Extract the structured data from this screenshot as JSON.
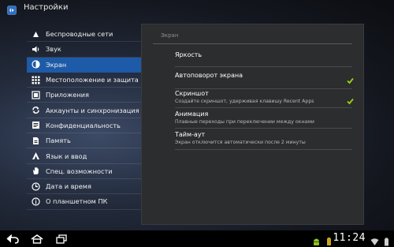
{
  "header": {
    "title": "Настройки"
  },
  "menu": {
    "items": [
      {
        "label": "Беспроводные сети",
        "icon": "wireless-icon",
        "active": false
      },
      {
        "label": "Звук",
        "icon": "speaker-icon",
        "active": false
      },
      {
        "label": "Экран",
        "icon": "brightness-icon",
        "active": true
      },
      {
        "label": "Местоположение и защита",
        "icon": "location-grid-icon",
        "active": false
      },
      {
        "label": "Приложения",
        "icon": "apps-icon",
        "active": false
      },
      {
        "label": "Аккаунты и синхронизация",
        "icon": "sync-icon",
        "active": false
      },
      {
        "label": "Конфиденциальность",
        "icon": "privacy-icon",
        "active": false
      },
      {
        "label": "Память",
        "icon": "storage-icon",
        "active": false
      },
      {
        "label": "Язык и ввод",
        "icon": "language-icon",
        "active": false
      },
      {
        "label": "Спец. возможности",
        "icon": "hand-icon",
        "active": false
      },
      {
        "label": "Дата и время",
        "icon": "clock-icon",
        "active": false
      },
      {
        "label": "О планшетном ПК",
        "icon": "info-icon",
        "active": false
      }
    ]
  },
  "panel": {
    "title": "Экран",
    "settings": [
      {
        "title": "Яркость",
        "desc": "",
        "checked": null
      },
      {
        "title": "Автоповорот экрана",
        "desc": "",
        "checked": true
      },
      {
        "title": "Скриншот",
        "desc": "Создайте скриншот, удерживая клавишу Recent Apps",
        "checked": true
      },
      {
        "title": "Анимация",
        "desc": "Плавные переходы при переключении между окнами",
        "checked": null
      },
      {
        "title": "Тайм-аут",
        "desc": "Экран отключится автоматически после 2 минуты",
        "checked": null
      }
    ]
  },
  "statusbar": {
    "time": "11:24"
  },
  "colors": {
    "accent": "#1d5aa8",
    "check": "#9bd30f",
    "panel": "#2c2d2f"
  }
}
